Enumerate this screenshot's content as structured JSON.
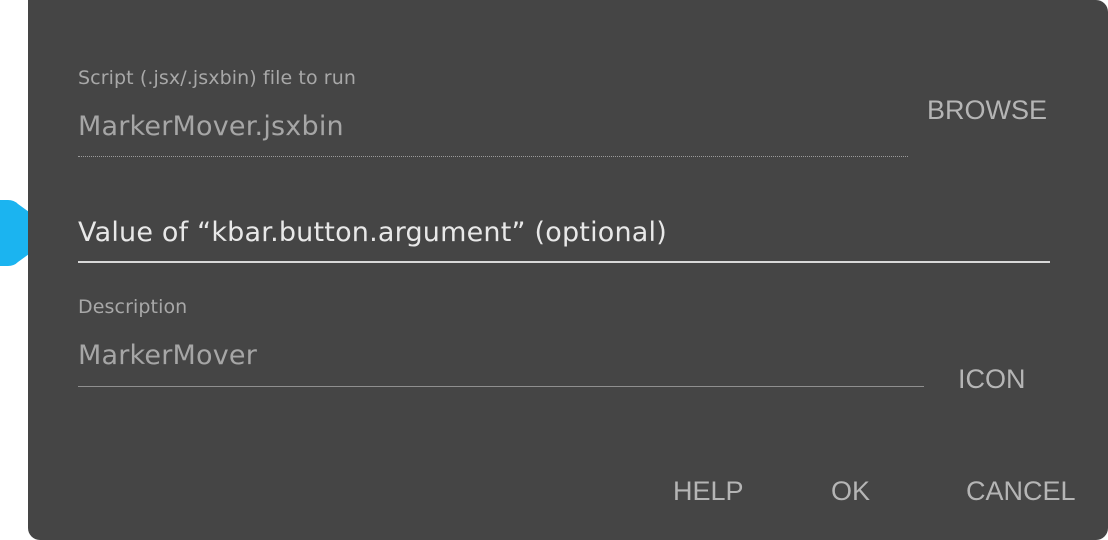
{
  "dialog": {
    "script_field": {
      "label": "Script (.jsx/.jsxbin) file to run",
      "value": "MarkerMover.jsxbin"
    },
    "browse_button": "BROWSE",
    "argument_field": {
      "placeholder": "Value of “kbar.button.argument” (optional)",
      "value": ""
    },
    "description_field": {
      "label": "Description",
      "value": "MarkerMover"
    },
    "icon_button": "ICON",
    "footer": {
      "help": "HELP",
      "ok": "OK",
      "cancel": "CANCEL"
    }
  },
  "colors": {
    "background": "#454545",
    "pointer": "#1bb4f0"
  },
  "icons": {
    "pointer": "pointer-arrow-icon"
  }
}
